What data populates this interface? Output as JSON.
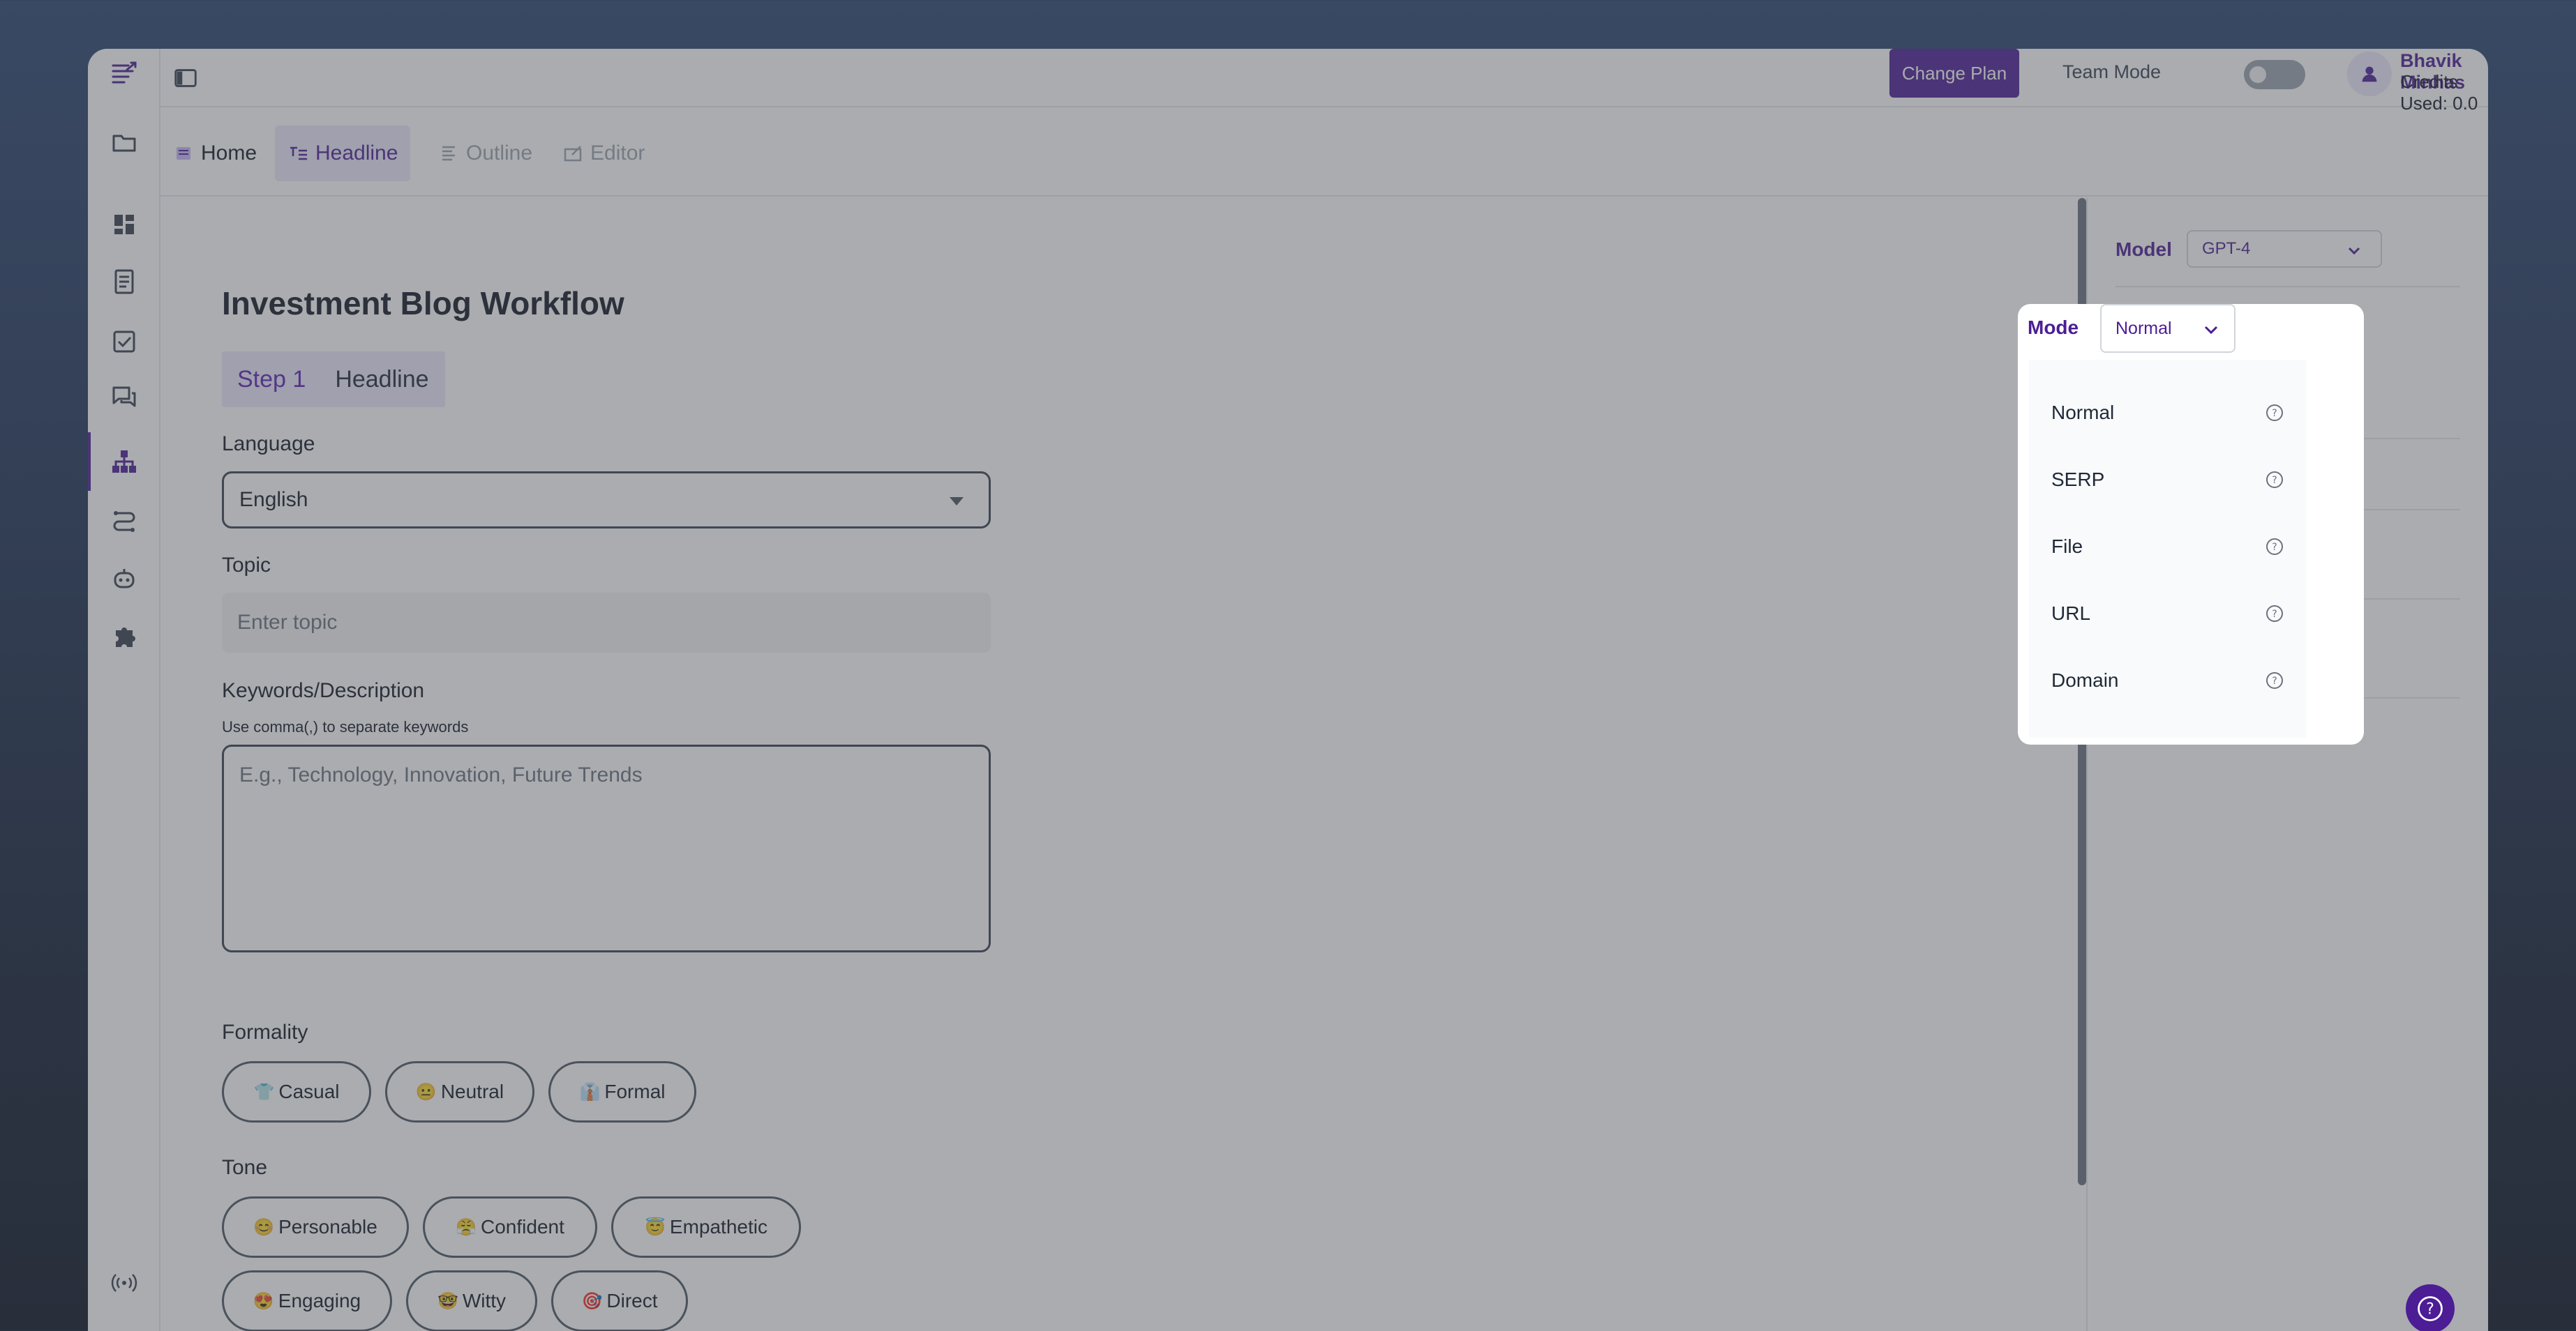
{
  "header": {
    "change_plan": "Change Plan",
    "team_mode": "Team Mode",
    "user_name": "Bhavik Minhas",
    "credits": "Credits Used: 0.0"
  },
  "tabs": [
    {
      "label": "Home"
    },
    {
      "label": "Headline"
    },
    {
      "label": "Outline"
    },
    {
      "label": "Editor"
    }
  ],
  "main": {
    "title": "Investment Blog Workflow",
    "step_number": "Step 1",
    "step_name": "Headline",
    "language_label": "Language",
    "language_value": "English",
    "topic_label": "Topic",
    "topic_placeholder": "Enter topic",
    "keywords_label": "Keywords/Description",
    "keywords_hint": "Use comma(,) to separate keywords",
    "keywords_placeholder": "E.g., Technology, Innovation, Future Trends",
    "formality_label": "Formality",
    "formality_options": [
      {
        "emoji": "👕",
        "label": "Casual"
      },
      {
        "emoji": "😐",
        "label": "Neutral"
      },
      {
        "emoji": "👔",
        "label": "Formal"
      }
    ],
    "tone_label": "Tone",
    "tone_options": [
      {
        "emoji": "😊",
        "label": "Personable"
      },
      {
        "emoji": "😤",
        "label": "Confident"
      },
      {
        "emoji": "😇",
        "label": "Empathetic"
      },
      {
        "emoji": "😍",
        "label": "Engaging"
      },
      {
        "emoji": "🤓",
        "label": "Witty"
      },
      {
        "emoji": "🎯",
        "label": "Direct"
      }
    ]
  },
  "settings": {
    "model_label": "Model",
    "model_value": "GPT-4",
    "mode_label": "Mode",
    "mode_value": "Normal",
    "mode_options": [
      "Normal",
      "SERP",
      "File",
      "URL",
      "Domain"
    ]
  },
  "colors": {
    "brand": "#4c1d95",
    "brand_light": "#ede9fe",
    "overlay": "rgba(75,78,85,0.47)"
  }
}
